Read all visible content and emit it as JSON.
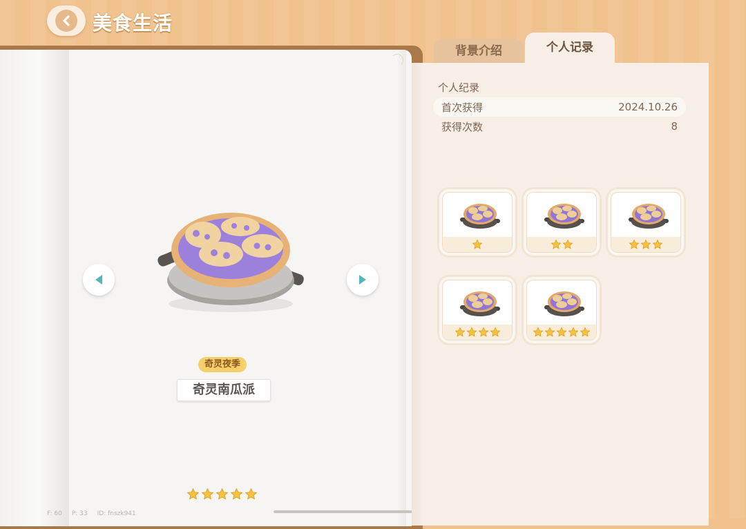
{
  "header": {
    "title": "美食生活",
    "back_icon": "chevron-left-icon"
  },
  "tabs": [
    {
      "label": "背景介绍",
      "active": false
    },
    {
      "label": "个人记录",
      "active": true
    }
  ],
  "food": {
    "season": "奇灵夜季",
    "name": "奇灵南瓜派",
    "rating_stars": 5
  },
  "record": {
    "section_title": "个人纪录",
    "rows": [
      {
        "label": "首次获得",
        "value": "2024.10.26"
      },
      {
        "label": "获得次数",
        "value": "8"
      }
    ]
  },
  "variants": [
    {
      "stars": 1
    },
    {
      "stars": 2
    },
    {
      "stars": 3
    },
    {
      "stars": 4
    },
    {
      "stars": 5
    }
  ],
  "debug": {
    "f": "F: 60",
    "p": "P: 33",
    "id": "ID: fnszk941"
  },
  "colors": {
    "accent": "#f0c28d",
    "star": "#f5c242",
    "arrow": "#52b7b6",
    "badge": "#f5cf6c"
  }
}
